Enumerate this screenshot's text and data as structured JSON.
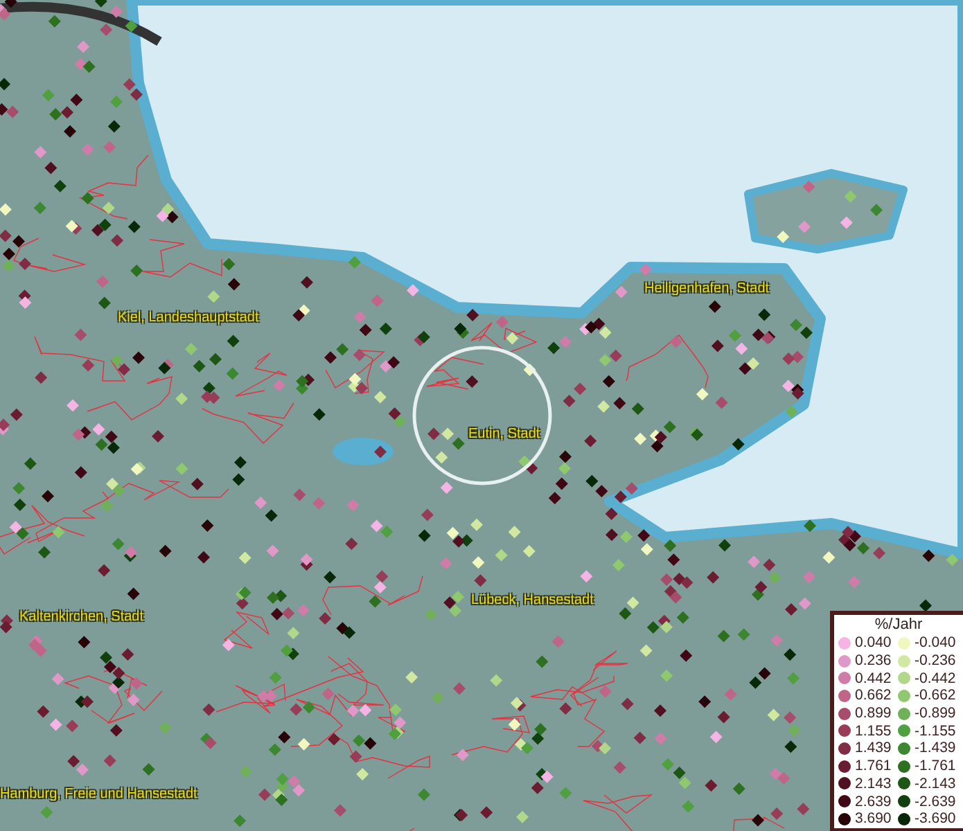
{
  "place_labels": [
    "Kiel, Landeshauptstadt",
    "Heiligenhafen, Stadt",
    "Eutin, Stadt",
    "Lübeck, Hansestadt",
    "Kaltenkirchen, Stadt",
    "Hamburg, Freie und Hansestadt"
  ],
  "legend": {
    "title": "%/Jahr",
    "increase": [
      {
        "value": "0.040",
        "color": "#f4b4e4"
      },
      {
        "value": "0.236",
        "color": "#e098c8"
      },
      {
        "value": "0.442",
        "color": "#d07ca8"
      },
      {
        "value": "0.662",
        "color": "#c06488"
      },
      {
        "value": "0.899",
        "color": "#a84c6c"
      },
      {
        "value": "1.155",
        "color": "#983c58"
      },
      {
        "value": "1.439",
        "color": "#802c44"
      },
      {
        "value": "1.761",
        "color": "#6c1c30"
      },
      {
        "value": "2.143",
        "color": "#501020"
      },
      {
        "value": "2.639",
        "color": "#400814"
      },
      {
        "value": "3.690",
        "color": "#280408"
      }
    ],
    "decrease": [
      {
        "value": "-0.040",
        "color": "#f0f8c0"
      },
      {
        "value": "-0.236",
        "color": "#d0e8a0"
      },
      {
        "value": "-0.442",
        "color": "#b0d888"
      },
      {
        "value": "-0.662",
        "color": "#90c870"
      },
      {
        "value": "-0.899",
        "color": "#70b058"
      },
      {
        "value": "-1.155",
        "color": "#50a040"
      },
      {
        "value": "-1.439",
        "color": "#3c8830"
      },
      {
        "value": "-1.761",
        "color": "#2c7020"
      },
      {
        "value": "-2.143",
        "color": "#1c5814"
      },
      {
        "value": "-2.639",
        "color": "#10400c"
      },
      {
        "value": "-3.690",
        "color": "#082808"
      }
    ]
  }
}
